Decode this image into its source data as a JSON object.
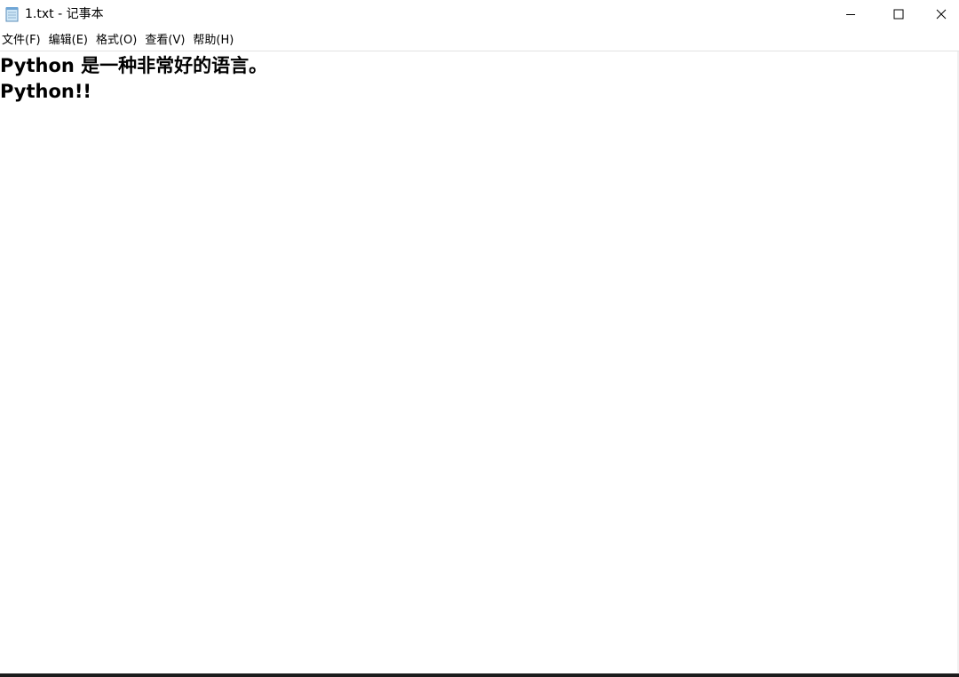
{
  "window": {
    "title": "1.txt - 记事本"
  },
  "menu": {
    "items": [
      {
        "label": "文件(F)"
      },
      {
        "label": "编辑(E)"
      },
      {
        "label": "格式(O)"
      },
      {
        "label": "查看(V)"
      },
      {
        "label": "帮助(H)"
      }
    ]
  },
  "editor": {
    "lines": [
      "Python 是一种非常好的语言。",
      "Python!!"
    ]
  },
  "icons": {
    "app": "notepad-icon",
    "minimize": "minimize-icon",
    "maximize": "maximize-icon",
    "close": "close-icon"
  },
  "colors": {
    "background": "#ffffff",
    "text": "#000000",
    "taskbar": "#1c1c1c"
  }
}
